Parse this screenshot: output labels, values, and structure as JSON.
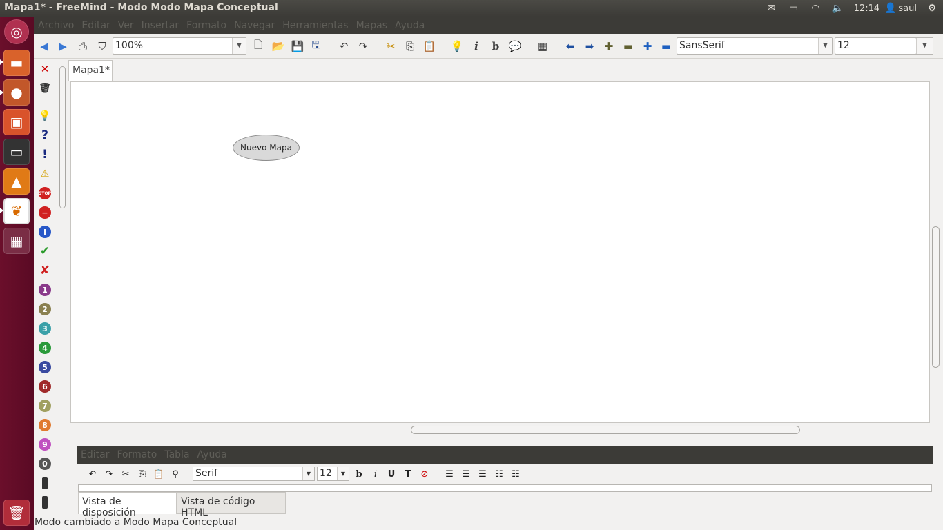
{
  "window": {
    "title": "Mapa1* - FreeMind - Modo Modo Mapa Conceptual"
  },
  "tray": {
    "mail_icon": "envelope-icon",
    "battery_icon": "battery-icon",
    "wifi_icon": "wifi-icon",
    "volume_icon": "volume-icon",
    "clock": "12:14",
    "user": "saul",
    "settings_icon": "gear-icon"
  },
  "menu": [
    "Archivo",
    "Editar",
    "Ver",
    "Insertar",
    "Formato",
    "Navegar",
    "Herramientas",
    "Mapas",
    "Ayuda"
  ],
  "toolbar": {
    "zoom": "100%",
    "font": "SansSerif",
    "font_size": "12"
  },
  "tab": {
    "label": "Mapa1*"
  },
  "node": {
    "label": "Nuevo Mapa"
  },
  "editor": {
    "menu": [
      "Editar",
      "Formato",
      "Tabla",
      "Ayuda"
    ],
    "font": "Serif",
    "font_size": "12",
    "tab_layout": "Vista de disposición",
    "tab_html": "Vista de código HTML"
  },
  "status": "Modo cambiado a Modo Mapa Conceptual",
  "colors": {
    "launcher": "#6b0f2b",
    "topbar": "#3c3b37",
    "node_fill": "#d9d9d9"
  }
}
